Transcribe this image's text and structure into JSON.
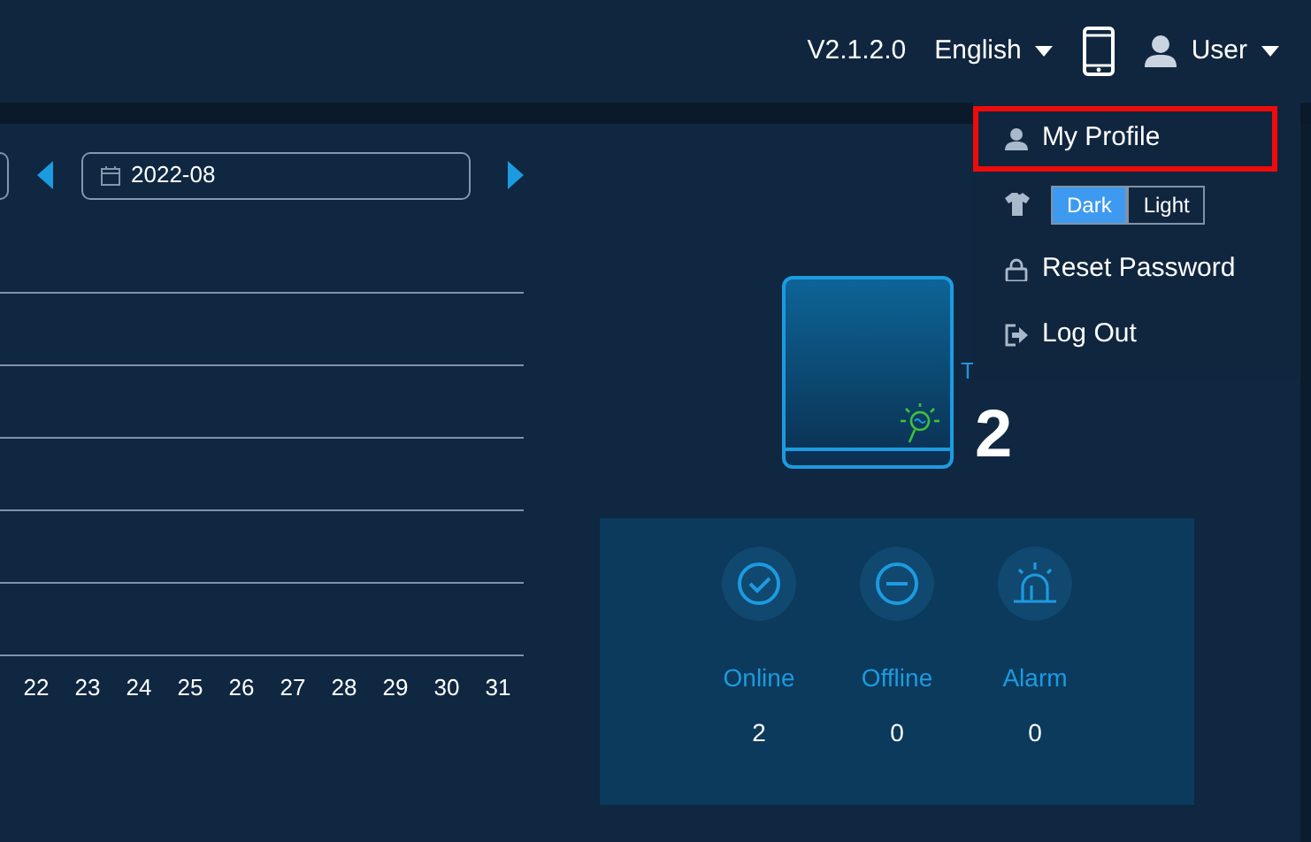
{
  "header": {
    "version": "V2.1.2.0",
    "language": "English",
    "user": "User"
  },
  "user_menu": [
    {
      "kind": "profile",
      "label": "My Profile",
      "highlighted": true
    },
    {
      "kind": "theme",
      "options": [
        {
          "label": "Dark",
          "selected": true
        },
        {
          "label": "Light",
          "selected": false
        }
      ]
    },
    {
      "kind": "password",
      "label": "Reset Password",
      "highlighted": false
    },
    {
      "kind": "logout",
      "label": "Log Out",
      "highlighted": false
    }
  ],
  "date_picker": {
    "value": "2022-08"
  },
  "chart": {
    "x_labels": [
      "22",
      "23",
      "24",
      "25",
      "26",
      "27",
      "28",
      "29",
      "30",
      "31"
    ]
  },
  "device": {
    "label": "T",
    "count": "2"
  },
  "stats": [
    {
      "kind": "online",
      "label": "Online",
      "value": "2"
    },
    {
      "kind": "offline",
      "label": "Offline",
      "value": "0"
    },
    {
      "kind": "alarm",
      "label": "Alarm",
      "value": "0"
    }
  ]
}
